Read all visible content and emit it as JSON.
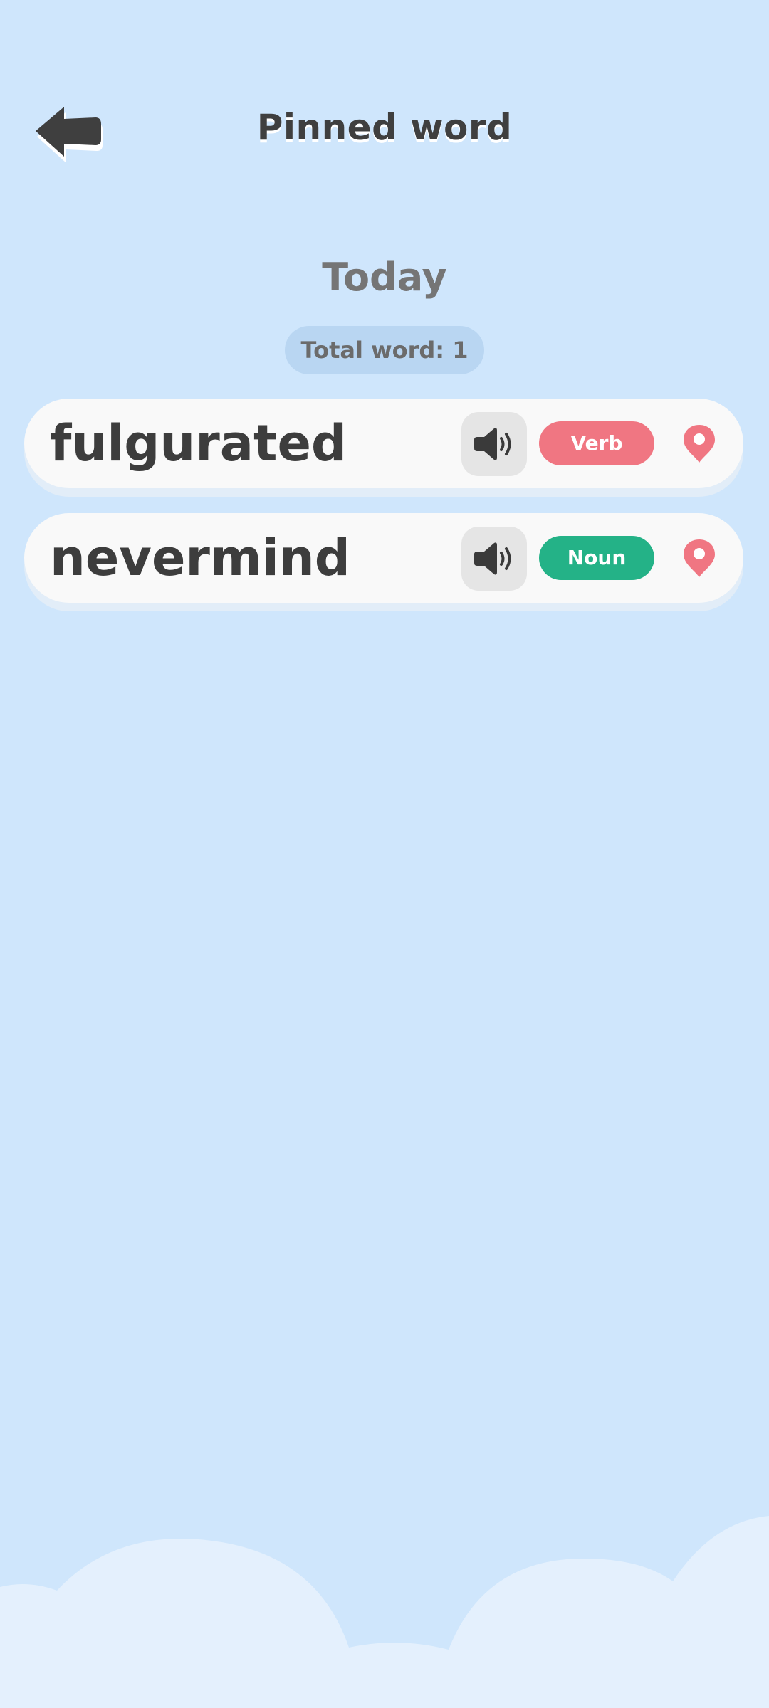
{
  "header": {
    "title": "Pinned word",
    "back_icon": "back-arrow-icon"
  },
  "section": {
    "title": "Today",
    "count_label": "Total word: 1"
  },
  "words": [
    {
      "word": "fulgurated",
      "part_of_speech": "Verb",
      "badge_color": "#f07682",
      "speaker_icon": "speaker-icon",
      "pin_icon": "pin-icon"
    },
    {
      "word": "nevermind",
      "part_of_speech": "Noun",
      "badge_color": "#24b287",
      "speaker_icon": "speaker-icon",
      "pin_icon": "pin-icon"
    }
  ],
  "colors": {
    "background": "#cfe6fc",
    "card": "#f9f9f9",
    "pin": "#f07682",
    "title": "#3f3f3f",
    "cloud": "#e4f0fd"
  }
}
